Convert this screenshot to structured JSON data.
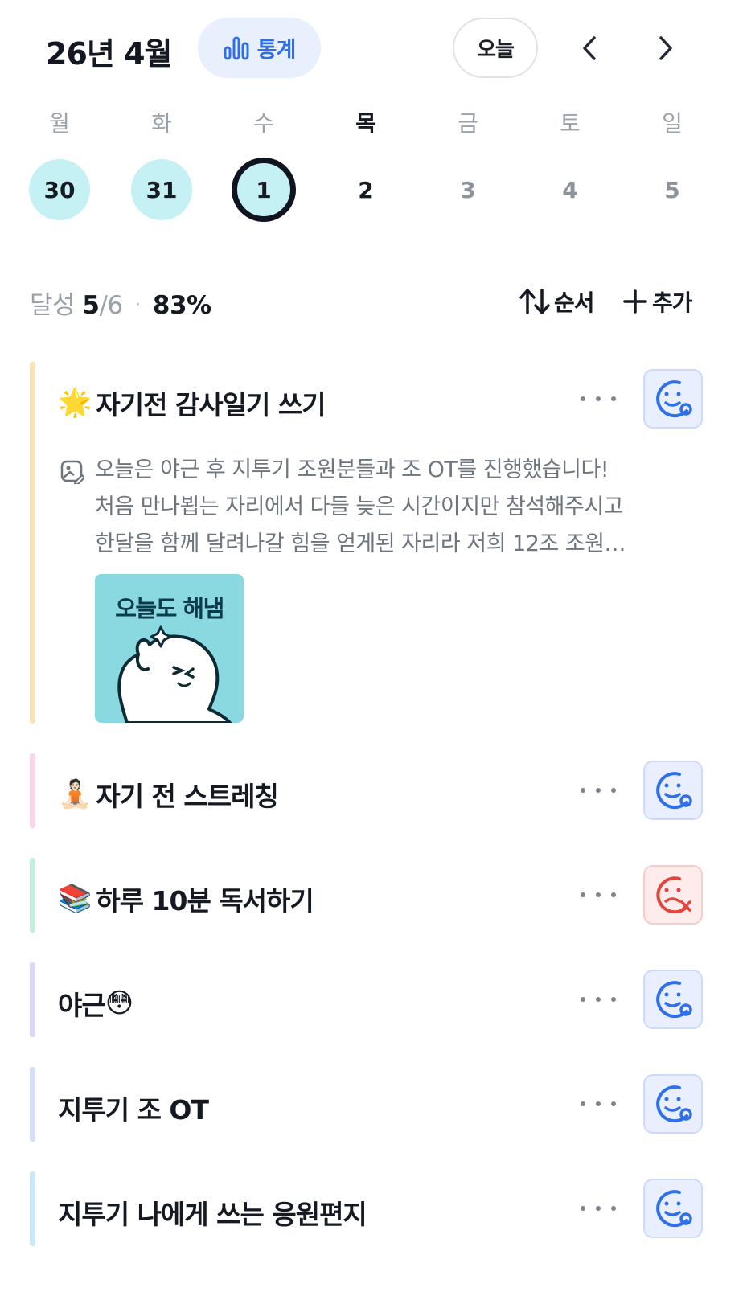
{
  "header": {
    "month_title": "26년 4월",
    "stats_label": "통계",
    "today_label": "오늘",
    "accent_color": "#2f6fea"
  },
  "week": {
    "weekdays": [
      "월",
      "화",
      "수",
      "목",
      "금",
      "토",
      "일"
    ],
    "days": [
      "30",
      "31",
      "1",
      "2",
      "3",
      "4",
      "5"
    ],
    "today_index": 3,
    "selected_index": 2,
    "completed_days": [
      "30",
      "31",
      "1"
    ]
  },
  "summary": {
    "label": "달성",
    "done": "5",
    "total": "/6",
    "separator": "·",
    "percent": "83%",
    "sort_label": "순서",
    "add_label": "추가"
  },
  "habits": [
    {
      "emoji": "🌟",
      "title": "자기전 감사일기 쓰기",
      "bar_color": "#fbe3b6",
      "status": "done",
      "note_lines": [
        "오늘은 야근 후 지투기 조원분들과 조 OT를 진행했습니다!",
        "처음 만나뵙는 자리에서 다들 늦은 시간이지만 참석해주시고",
        "한달을 함께 달려나갈 힘을 얻게된 자리라 저희 12조 조원…"
      ],
      "sticker_text": "오늘도 해냄"
    },
    {
      "emoji": "🧘🏻",
      "title": "자기 전 스트레칭",
      "bar_color": "#fbd6ea",
      "status": "done"
    },
    {
      "emoji": "📚",
      "title": "하루 10분 독서하기",
      "bar_color": "#c4efd9",
      "status": "failed"
    },
    {
      "emoji": "😳",
      "title": "야근",
      "bar_color": "#dcd7f8",
      "status": "done"
    },
    {
      "emoji": "",
      "title": "지투기 조 OT",
      "bar_color": "#d6def8",
      "status": "done"
    },
    {
      "emoji": "",
      "title": "지투기 나에게 쓰는 응원편지",
      "bar_color": "#c8e8fb",
      "status": "done"
    }
  ]
}
